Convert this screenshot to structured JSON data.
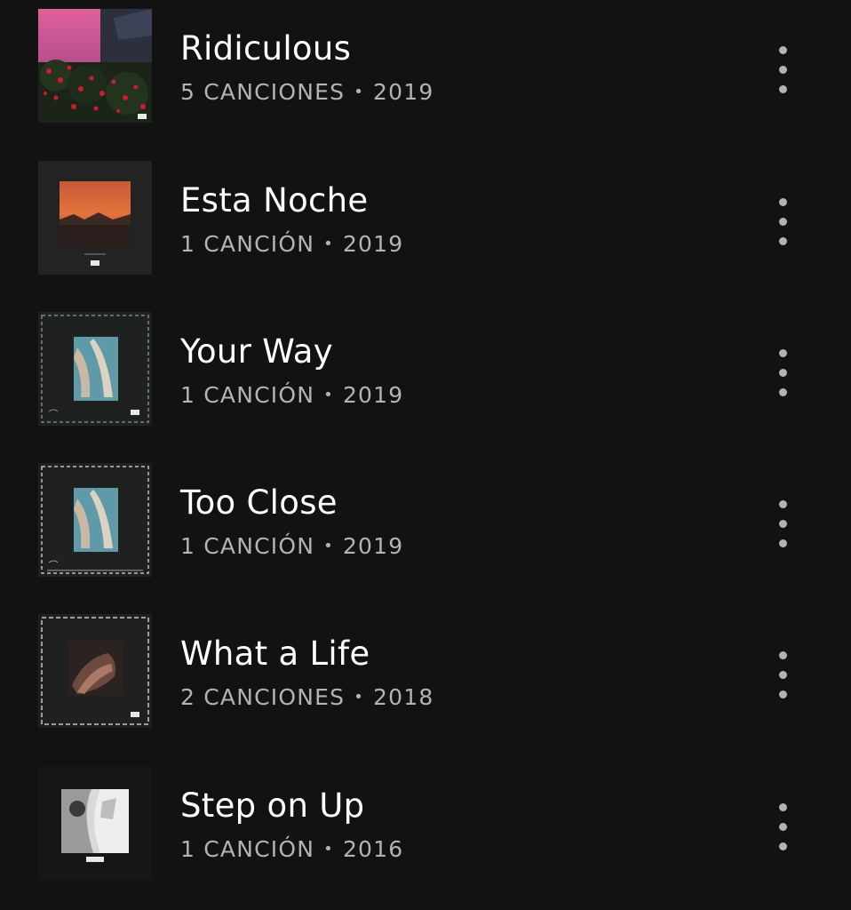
{
  "releases": [
    {
      "title": "Ridiculous",
      "count": "5 CANCIONES",
      "separator": "•",
      "year": "2019",
      "cover_icon": "pink-sky-roses-artwork"
    },
    {
      "title": "Esta Noche",
      "count": "1 CANCIÓN",
      "separator": "•",
      "year": "2019",
      "cover_icon": "sunset-photo-artwork"
    },
    {
      "title": "Your Way",
      "count": "1 CANCIÓN",
      "separator": "•",
      "year": "2019",
      "cover_icon": "painting-framed-artwork"
    },
    {
      "title": "Too Close",
      "count": "1 CANCIÓN",
      "separator": "•",
      "year": "2019",
      "cover_icon": "painting-framed-artwork"
    },
    {
      "title": "What a Life",
      "count": "2 CANCIONES",
      "separator": "•",
      "year": "2018",
      "cover_icon": "dark-portrait-framed-artwork"
    },
    {
      "title": "Step on Up",
      "count": "1 CANCIÓN",
      "separator": "•",
      "year": "2016",
      "cover_icon": "black-white-photo-artwork"
    }
  ],
  "colors": {
    "background": "#121212",
    "title_text": "#ffffff",
    "meta_text": "#b3b3b3"
  }
}
